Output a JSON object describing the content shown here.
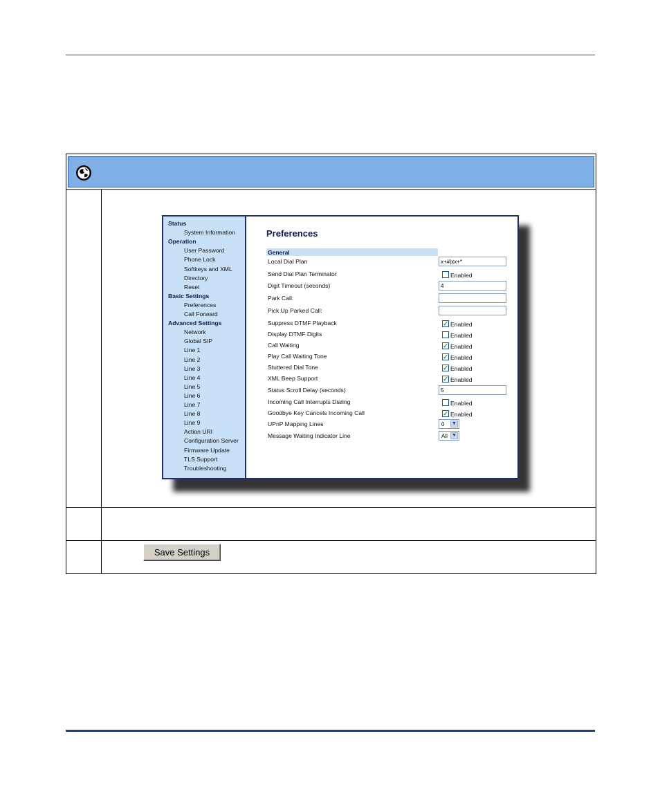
{
  "sidebar": {
    "items": [
      {
        "label": "Status",
        "type": "cat"
      },
      {
        "label": "System Information",
        "type": "sub"
      },
      {
        "label": "Operation",
        "type": "cat"
      },
      {
        "label": "User Password",
        "type": "sub"
      },
      {
        "label": "Phone Lock",
        "type": "sub"
      },
      {
        "label": "Softkeys and XML",
        "type": "sub"
      },
      {
        "label": "Directory",
        "type": "sub"
      },
      {
        "label": "Reset",
        "type": "sub"
      },
      {
        "label": "Basic Settings",
        "type": "cat"
      },
      {
        "label": "Preferences",
        "type": "sub"
      },
      {
        "label": "Call Forward",
        "type": "sub"
      },
      {
        "label": "Advanced Settings",
        "type": "cat"
      },
      {
        "label": "Network",
        "type": "sub"
      },
      {
        "label": "Global SIP",
        "type": "sub"
      },
      {
        "label": "Line 1",
        "type": "sub"
      },
      {
        "label": "Line 2",
        "type": "sub"
      },
      {
        "label": "Line 3",
        "type": "sub"
      },
      {
        "label": "Line 4",
        "type": "sub"
      },
      {
        "label": "Line 5",
        "type": "sub"
      },
      {
        "label": "Line 6",
        "type": "sub"
      },
      {
        "label": "Line 7",
        "type": "sub"
      },
      {
        "label": "Line 8",
        "type": "sub"
      },
      {
        "label": "Line 9",
        "type": "sub"
      },
      {
        "label": "Action URI",
        "type": "sub"
      },
      {
        "label": "Configuration Server",
        "type": "sub"
      },
      {
        "label": "Firmware Update",
        "type": "sub"
      },
      {
        "label": "TLS Support",
        "type": "sub"
      },
      {
        "label": "Troubleshooting",
        "type": "sub"
      }
    ]
  },
  "main": {
    "title": "Preferences",
    "section": "General",
    "settings": [
      {
        "label": "Local Dial Plan",
        "control": "text",
        "value": "x+#|xx+*"
      },
      {
        "label": "Send Dial Plan Terminator",
        "control": "check",
        "checked": false,
        "text": "Enabled"
      },
      {
        "label": "Digit Timeout (seconds)",
        "control": "text",
        "value": "4"
      },
      {
        "label": "Park Call:",
        "control": "text",
        "value": ""
      },
      {
        "label": "Pick Up Parked Call:",
        "control": "text",
        "value": ""
      },
      {
        "label": "Suppress DTMF Playback",
        "control": "check",
        "checked": true,
        "text": "Enabled"
      },
      {
        "label": "Display DTMF Digits",
        "control": "check",
        "checked": false,
        "text": "Enabled"
      },
      {
        "label": "Call Waiting",
        "control": "check",
        "checked": true,
        "text": "Enabled"
      },
      {
        "label": "Play Call Waiting Tone",
        "control": "check",
        "checked": true,
        "text": "Enabled"
      },
      {
        "label": "Stuttered Dial Tone",
        "control": "check",
        "checked": true,
        "text": "Enabled"
      },
      {
        "label": "XML Beep Support",
        "control": "check",
        "checked": true,
        "text": "Enabled"
      },
      {
        "label": "Status Scroll Delay (seconds)",
        "control": "text",
        "value": "5"
      },
      {
        "label": "Incoming Call Interrupts Dialing",
        "control": "check",
        "checked": false,
        "text": "Enabled"
      },
      {
        "label": "Goodbye Key Cancels Incoming Call",
        "control": "check",
        "checked": true,
        "text": "Enabled"
      },
      {
        "label": "UPnP Mapping Lines",
        "control": "select",
        "value": "0"
      },
      {
        "label": "Message Waiting Indicator Line",
        "control": "select",
        "value": "All"
      }
    ]
  },
  "save_button": {
    "label": "Save Settings"
  },
  "colors": {
    "header_band": "#7fb0e8",
    "sidebar_bg": "#c9e1f7",
    "rule": "#1f3f7a",
    "check": "#1a9b2b"
  }
}
